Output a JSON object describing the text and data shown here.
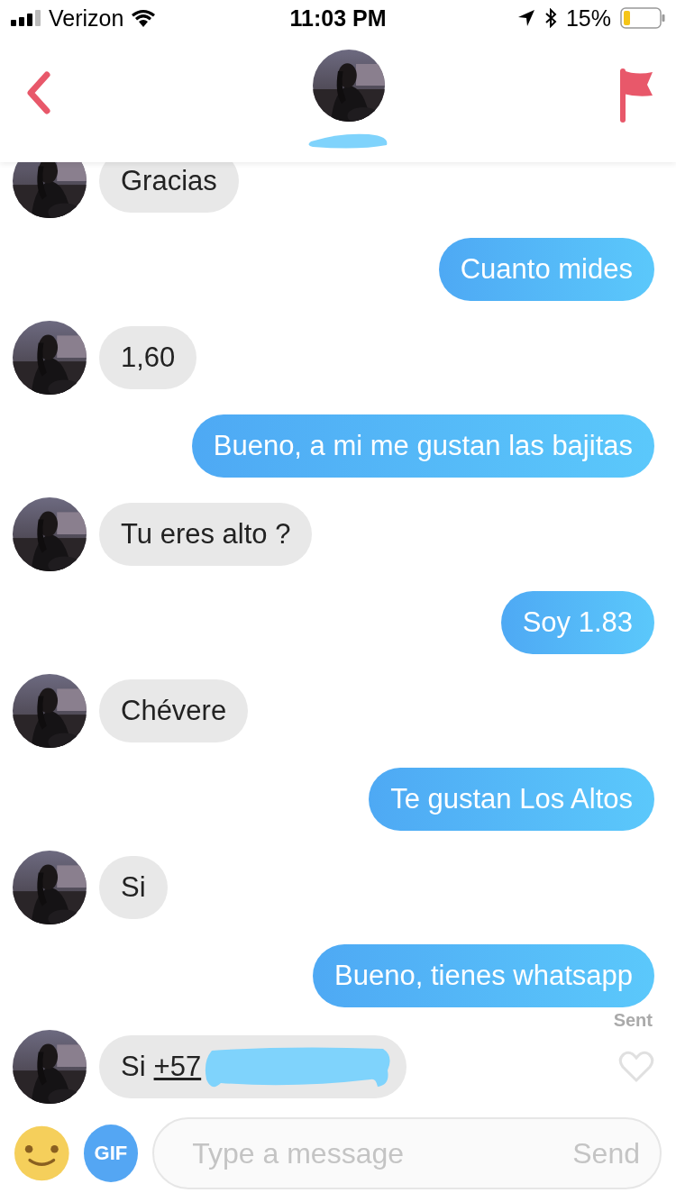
{
  "status_bar": {
    "carrier": "Verizon",
    "time": "11:03 PM",
    "battery": "15%"
  },
  "header": {
    "name_redacted": true
  },
  "messages": [
    {
      "kind": "received",
      "text": "Gracias"
    },
    {
      "kind": "sent",
      "text": "Cuanto mides"
    },
    {
      "kind": "received",
      "text": "1,60"
    },
    {
      "kind": "sent",
      "text": "Bueno, a mi me gustan las bajitas"
    },
    {
      "kind": "received",
      "text": "Tu eres alto ?"
    },
    {
      "kind": "sent",
      "text": "Soy 1.83"
    },
    {
      "kind": "received",
      "text": "Chévere"
    },
    {
      "kind": "sent",
      "text": "Te gustan Los Altos"
    },
    {
      "kind": "received",
      "text": "Si"
    },
    {
      "kind": "sent",
      "text": "Bueno, tienes whatsapp",
      "status": "Sent"
    },
    {
      "kind": "received",
      "text": "Si",
      "link": "+57",
      "redacted": true,
      "liked": false
    }
  ],
  "composer": {
    "gif": "GIF",
    "placeholder": "Type a message",
    "send": "Send"
  }
}
